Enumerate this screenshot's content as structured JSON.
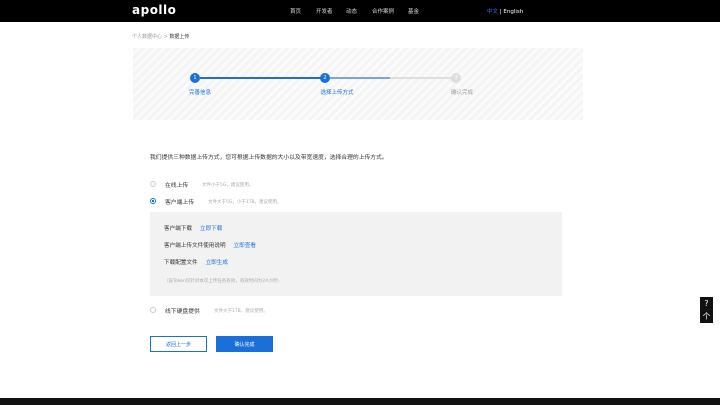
{
  "nav": {
    "logo": "apollo",
    "items": [
      "首页",
      "开发者",
      "动态",
      "合作案例",
      "基金"
    ],
    "lang_cn": "中文",
    "lang_sep": " | ",
    "lang_en": "English"
  },
  "breadcrumb": {
    "parent": "个人数据中心",
    "sep": " > ",
    "current": "数据上传"
  },
  "steps": [
    {
      "num": "1",
      "label": "完善信息",
      "state": "done"
    },
    {
      "num": "2",
      "label": "选择上传方式",
      "state": "active"
    },
    {
      "num": "3",
      "label": "确认完成",
      "state": "pending"
    }
  ],
  "intro": "我们提供三种数据上传方式，您可根据上传数据的大小以及带宽速度，选择合理的上传方式。",
  "options": [
    {
      "label": "在线上传",
      "hint": "文件小于5G，建议使用。",
      "selected": false
    },
    {
      "label": "客户端上传",
      "hint": "文件大于5G，小于1TB，建议使用。",
      "selected": true
    },
    {
      "label": "线下硬盘提供",
      "hint": "文件大于1TB，建议使用。",
      "selected": false
    }
  ],
  "client": {
    "rows": [
      {
        "label": "客户端下载",
        "link": "立即下载"
      },
      {
        "label": "客户端上传文件使用说明",
        "link": "立即查看"
      },
      {
        "label": "下载配置文件",
        "link": "立即生成"
      }
    ],
    "note": "（该Token仅针对本次上传任务有效，有效时间为24小时）"
  },
  "buttons": {
    "back": "返回上一步",
    "confirm": "确认完成"
  },
  "side": {
    "help": "?",
    "top": "个"
  },
  "colors": {
    "accent": "#1a6fd8"
  }
}
